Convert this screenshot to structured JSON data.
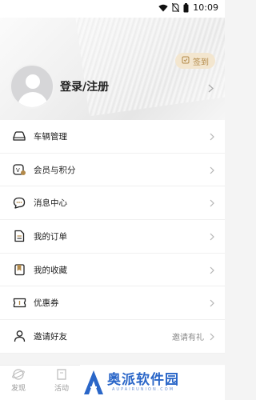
{
  "status_bar": {
    "time": "10:09"
  },
  "header": {
    "checkin_label": "签到",
    "login_label": "登录/注册"
  },
  "menu": {
    "items": [
      {
        "label": "车辆管理",
        "icon": "car-icon",
        "extra": ""
      },
      {
        "label": "会员与积分",
        "icon": "membership-card-icon",
        "extra": ""
      },
      {
        "label": "消息中心",
        "icon": "chat-bubble-icon",
        "extra": ""
      },
      {
        "label": "我的订单",
        "icon": "order-list-icon",
        "extra": ""
      },
      {
        "label": "我的收藏",
        "icon": "favorites-icon",
        "extra": ""
      },
      {
        "label": "优惠券",
        "icon": "coupon-ticket-icon",
        "extra": ""
      },
      {
        "label": "邀请好友",
        "icon": "person-icon",
        "extra": "邀请有礼"
      }
    ]
  },
  "tabbar": {
    "tabs": [
      {
        "label": "发现",
        "icon": "discover-icon"
      },
      {
        "label": "活动",
        "icon": "activity-icon"
      }
    ]
  },
  "watermark": {
    "title": "奥派软件园",
    "subtitle": "AUPAIRUNION.COM"
  },
  "colors": {
    "accent_gold": "#b38a4a",
    "checkin_bg": "#f3e6cf",
    "watermark_blue": "#2a66c8"
  }
}
